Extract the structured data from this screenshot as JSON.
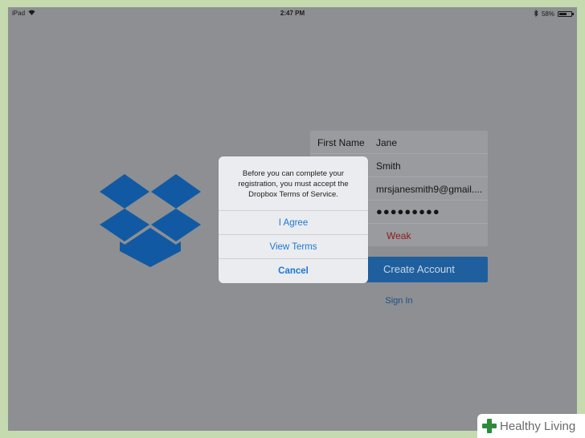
{
  "status_bar": {
    "device": "iPad",
    "time": "2:47 PM",
    "battery": "58%"
  },
  "form": {
    "first_name_label": "First Name",
    "first_name_value": "Jane",
    "last_name_value": "Smith",
    "email_value": "mrsjanesmith9@gmail....",
    "password_value": "●●●●●●●●●",
    "password_strength": "Weak"
  },
  "create_account_label": "Create Account",
  "sign_in_label": "Sign In",
  "alert": {
    "message": "Before you can complete your\nregistration, you must accept the\nDropbox Terms of Service.",
    "agree_label": "I Agree",
    "view_terms_label": "View Terms",
    "cancel_label": "Cancel"
  },
  "colors": {
    "overlay": "#8e8f92",
    "dropbox_blue": "#115aa3",
    "button_blue": "#1f5f9e",
    "alert_link": "#1a78d4",
    "weak_red": "#8c1b1b"
  },
  "watermark": "Healthy Living"
}
